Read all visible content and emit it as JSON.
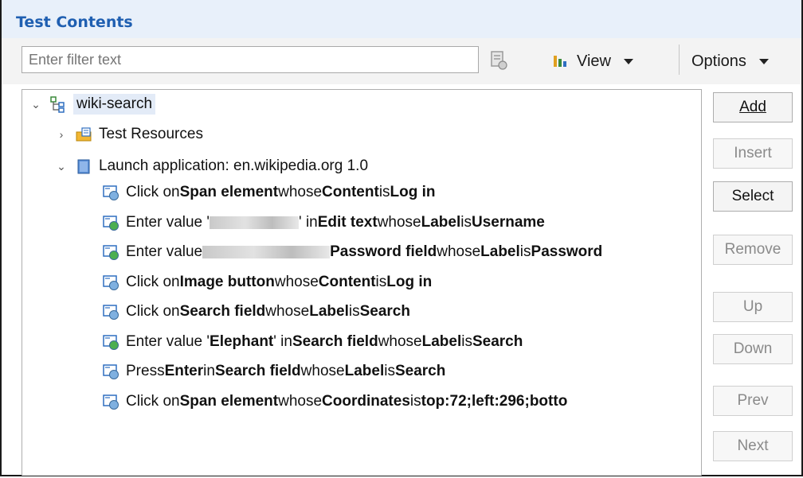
{
  "panel": {
    "title": "Test Contents"
  },
  "filter": {
    "placeholder": "Enter filter text",
    "value": ""
  },
  "toolbar": {
    "view_label": "View",
    "options_label": "Options"
  },
  "tree": {
    "root": "wiki-search",
    "resources": "Test Resources",
    "launch": "Launch application: en.wikipedia.org  1.0",
    "steps": [
      {
        "parts": [
          [
            "t",
            "Click on "
          ],
          [
            "b",
            "Span element"
          ],
          [
            "t",
            " whose "
          ],
          [
            "b",
            "Content"
          ],
          [
            "t",
            " is "
          ],
          [
            "b",
            "Log in"
          ]
        ]
      },
      {
        "parts": [
          [
            "t",
            "Enter value '"
          ],
          [
            "r",
            ""
          ],
          [
            "t",
            "' in "
          ],
          [
            "b",
            "Edit text"
          ],
          [
            "t",
            " whose "
          ],
          [
            "b",
            "Label"
          ],
          [
            "t",
            " is "
          ],
          [
            "b",
            "Username"
          ]
        ]
      },
      {
        "parts": [
          [
            "t",
            "Enter value "
          ],
          [
            "r",
            ""
          ],
          [
            "t",
            " "
          ],
          [
            "b",
            "Password field"
          ],
          [
            "t",
            " whose "
          ],
          [
            "b",
            "Label"
          ],
          [
            "t",
            " is "
          ],
          [
            "b",
            "Password"
          ]
        ]
      },
      {
        "parts": [
          [
            "t",
            "Click on "
          ],
          [
            "b",
            "Image button"
          ],
          [
            "t",
            " whose "
          ],
          [
            "b",
            "Content"
          ],
          [
            "t",
            " is "
          ],
          [
            "b",
            "Log in"
          ]
        ]
      },
      {
        "parts": [
          [
            "t",
            "Click on "
          ],
          [
            "b",
            "Search field"
          ],
          [
            "t",
            " whose "
          ],
          [
            "b",
            "Label"
          ],
          [
            "t",
            " is "
          ],
          [
            "b",
            "Search"
          ]
        ]
      },
      {
        "parts": [
          [
            "t",
            "Enter value '"
          ],
          [
            "b",
            "Elephant"
          ],
          [
            "t",
            "' in "
          ],
          [
            "b",
            "Search field"
          ],
          [
            "t",
            " whose "
          ],
          [
            "b",
            "Label"
          ],
          [
            "t",
            " is "
          ],
          [
            "b",
            "Search"
          ]
        ]
      },
      {
        "parts": [
          [
            "t",
            "Press "
          ],
          [
            "b",
            "Enter"
          ],
          [
            "t",
            " in "
          ],
          [
            "b",
            "Search field"
          ],
          [
            "t",
            " whose "
          ],
          [
            "b",
            "Label"
          ],
          [
            "t",
            " is "
          ],
          [
            "b",
            "Search"
          ]
        ]
      },
      {
        "parts": [
          [
            "t",
            "Click on "
          ],
          [
            "b",
            "Span element"
          ],
          [
            "t",
            " whose "
          ],
          [
            "b",
            "Coordinates"
          ],
          [
            "t",
            " is "
          ],
          [
            "b",
            "top:72;left:296;botto"
          ]
        ]
      }
    ]
  },
  "buttons": {
    "add": "Add",
    "insert": "Insert",
    "select": "Select",
    "remove": "Remove",
    "up": "Up",
    "down": "Down",
    "prev": "Prev",
    "next": "Next"
  },
  "icons": {
    "root": "test-tree-icon",
    "resources": "resources-folder-icon",
    "launch": "launch-app-icon",
    "click_step": "click-step-icon",
    "enter_step": "enter-value-step-icon"
  },
  "colors": {
    "title": "#1f5fb1",
    "header_bg": "#e8f0fa",
    "selection": "#e3ebf7"
  }
}
